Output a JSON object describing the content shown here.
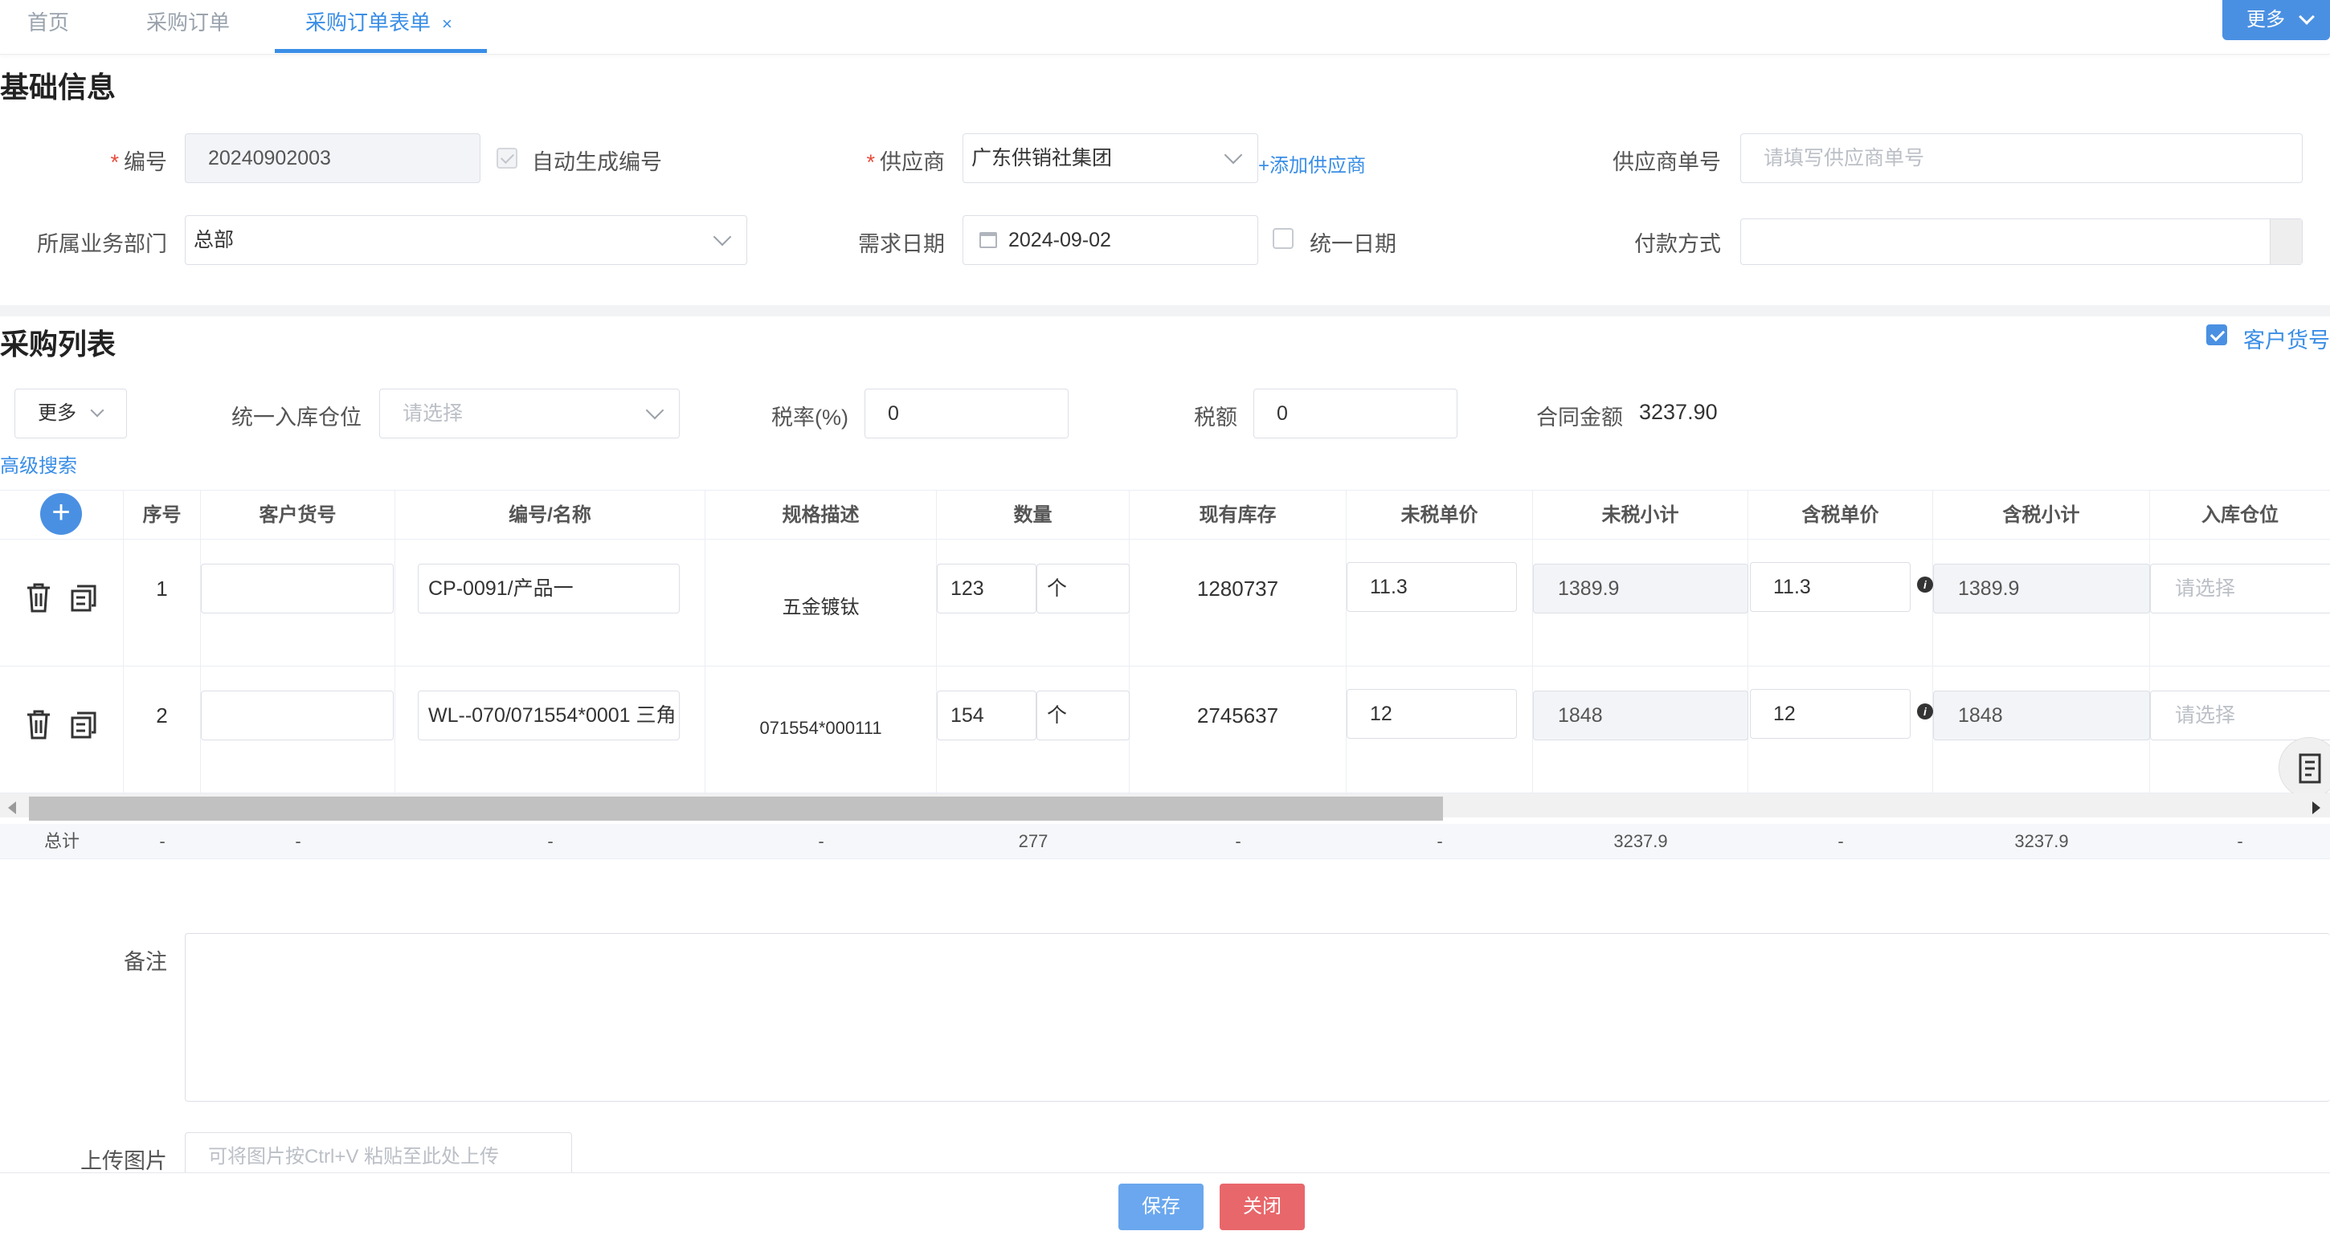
{
  "tabs": [
    {
      "label": "首页"
    },
    {
      "label": "采购订单"
    },
    {
      "label": "采购订单表单",
      "close": "×"
    }
  ],
  "top_more": "更多",
  "basic": {
    "title": "基础信息",
    "code_label": "编号",
    "code_value": "20240902003",
    "auto_code_label": "自动生成编号",
    "supplier_label": "供应商",
    "supplier_value": "广东供销社集团",
    "add_supplier": "+添加供应商",
    "supplier_no_label": "供应商单号",
    "supplier_no_placeholder": "请填写供应商单号",
    "dept_label": "所属业务部门",
    "dept_value": "总部",
    "date_label": "需求日期",
    "date_value": "2024-09-02",
    "unify_date_label": "统一日期",
    "payment_label": "付款方式"
  },
  "list": {
    "title": "采购列表",
    "customer_no_toggle": "客户货号",
    "more": "更多",
    "warehouse_label": "统一入库仓位",
    "warehouse_placeholder": "请选择",
    "tax_rate_label": "税率(%)",
    "tax_rate_value": "0",
    "tax_amount_label": "税额",
    "tax_amount_value": "0",
    "contract_label": "合同金额",
    "contract_value": "3237.90",
    "advanced_search": "高级搜索"
  },
  "table": {
    "headers": [
      "序号",
      "客户货号",
      "编号/名称",
      "规格描述",
      "数量",
      "现有库存",
      "未税单价",
      "未税小计",
      "含税单价",
      "含税小计",
      "入库仓位"
    ],
    "rows": [
      {
        "seq": "1",
        "customer_no": "",
        "code_name": "CP-0091/产品一",
        "spec": "五金镀钛",
        "qty": "123",
        "unit": "个",
        "stock": "1280737",
        "price": "11.3",
        "subtotal": "1389.9",
        "tax_price": "11.3",
        "tax_subtotal": "1389.9",
        "warehouse": "请选择"
      },
      {
        "seq": "2",
        "customer_no": "",
        "code_name": "WL--070/071554*0001  三角",
        "spec": "071554*000111",
        "qty": "154",
        "unit": "个",
        "stock": "2745637",
        "price": "12",
        "subtotal": "1848",
        "tax_price": "12",
        "tax_subtotal": "1848",
        "warehouse": "请选择"
      }
    ],
    "totals": {
      "label": "总计",
      "seq": "-",
      "customer_no": "-",
      "code_name": "-",
      "spec": "-",
      "qty": "277",
      "stock": "-",
      "price": "-",
      "subtotal": "3237.9",
      "tax_price": "-",
      "tax_subtotal": "3237.9",
      "warehouse": "-"
    }
  },
  "remark_label": "备注",
  "upload_label": "上传图片",
  "upload_placeholder": "可将图片按Ctrl+V 粘贴至此处上传",
  "footer": {
    "save": "保存",
    "close": "关闭"
  },
  "colors": {
    "accent": "#4a90e2",
    "danger": "#e8676b",
    "required": "#e74c3c"
  },
  "icons": [
    "chevron-down-icon",
    "calendar-icon",
    "trash-icon",
    "copy-icon",
    "plus-icon",
    "info-icon",
    "document-icon",
    "check-icon"
  ]
}
